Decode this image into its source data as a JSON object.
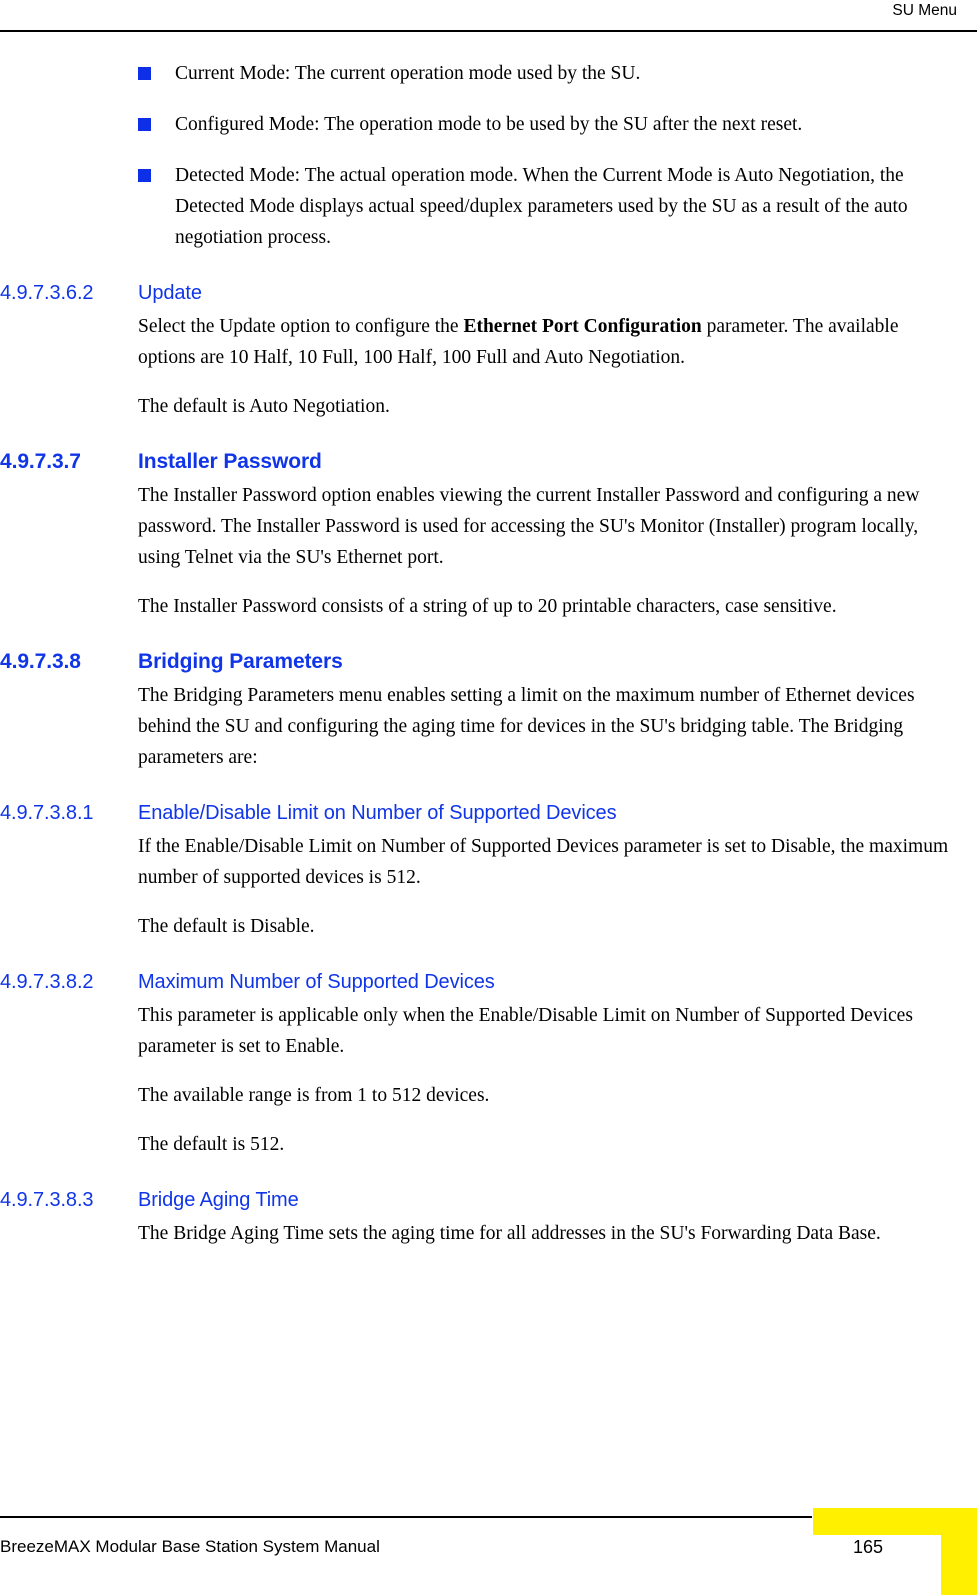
{
  "header": {
    "running_title": "SU Menu"
  },
  "bullets": [
    {
      "text": "Current Mode: The current operation mode used by the SU."
    },
    {
      "text": "Configured Mode: The operation mode to be used by the SU after the next reset."
    },
    {
      "text": "Detected Mode: The actual operation mode. When the Current Mode is Auto Negotiation, the Detected Mode displays actual speed/duplex parameters used by the SU as a result of the auto negotiation process."
    }
  ],
  "sections": [
    {
      "number": "4.9.7.3.6.2",
      "title": "Update",
      "level": 4,
      "paragraphs": [
        {
          "prefix": "Select the Update option to configure the ",
          "bold": "Ethernet Port Configuration",
          "suffix": " parameter. The available options are 10 Half, 10 Full, 100 Half, 100 Full and Auto Negotiation."
        },
        {
          "text": "The default is Auto Negotiation."
        }
      ]
    },
    {
      "number": "4.9.7.3.7",
      "title": "Installer Password",
      "level": 3,
      "paragraphs": [
        {
          "text": "The Installer Password option enables viewing the current Installer Password and configuring a new password. The Installer Password is used for accessing the SU's Monitor (Installer) program locally, using Telnet via the SU's Ethernet port."
        },
        {
          "text": "The Installer Password consists of a string of up to 20 printable characters, case sensitive."
        }
      ]
    },
    {
      "number": "4.9.7.3.8",
      "title": "Bridging Parameters",
      "level": 3,
      "paragraphs": [
        {
          "text": "The Bridging Parameters menu enables setting a limit on the maximum number of Ethernet devices behind the SU and configuring the aging time for devices in the SU's bridging table. The Bridging parameters are:"
        }
      ]
    },
    {
      "number": "4.9.7.3.8.1",
      "title": "Enable/Disable Limit on Number of Supported Devices",
      "level": 4,
      "paragraphs": [
        {
          "text": "If the Enable/Disable Limit on Number of Supported Devices parameter is set to Disable, the maximum number of supported devices is 512."
        },
        {
          "text": "The default is Disable."
        }
      ]
    },
    {
      "number": "4.9.7.3.8.2",
      "title": "Maximum Number of Supported Devices",
      "level": 4,
      "paragraphs": [
        {
          "text": "This parameter is applicable only when the Enable/Disable Limit on Number of Supported Devices parameter is set to Enable."
        },
        {
          "text": "The available range is from 1 to 512 devices."
        },
        {
          "text": "The default is 512."
        }
      ]
    },
    {
      "number": "4.9.7.3.8.3",
      "title": "Bridge Aging Time",
      "level": 4,
      "paragraphs": [
        {
          "text": "The Bridge Aging Time sets the aging time for all addresses in the SU's Forwarding Data Base."
        }
      ]
    }
  ],
  "footer": {
    "manual_title": "BreezeMAX Modular Base Station System Manual",
    "page_number": "165"
  },
  "colors": {
    "heading_blue": "#1035E8",
    "bullet_blue": "#0D2FE8",
    "page_tab_yellow": "#FFF000",
    "text_black": "#000000"
  }
}
